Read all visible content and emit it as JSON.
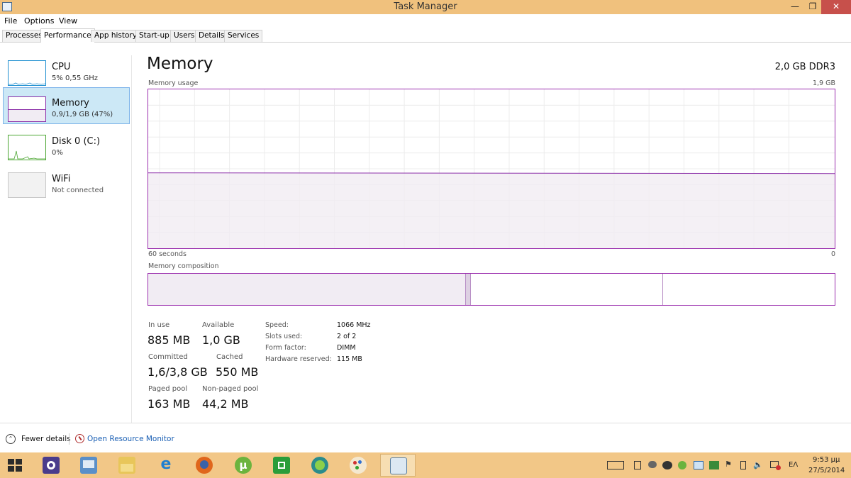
{
  "window": {
    "title": "Task Manager",
    "controls": {
      "minimize": "—",
      "maximize": "❐",
      "close": "✕"
    }
  },
  "menu": [
    "File",
    "Options",
    "View"
  ],
  "tabs": [
    {
      "label": "Processes",
      "active": false
    },
    {
      "label": "Performance",
      "active": true
    },
    {
      "label": "App history",
      "active": false
    },
    {
      "label": "Start-up",
      "active": false
    },
    {
      "label": "Users",
      "active": false
    },
    {
      "label": "Details",
      "active": false
    },
    {
      "label": "Services",
      "active": false
    }
  ],
  "sidebar": [
    {
      "name": "CPU",
      "sub": "5% 0,55 GHz",
      "color": "#1f8fd0"
    },
    {
      "name": "Memory",
      "sub": "0,9/1,9 GB (47%)",
      "color": "#8b2fa8"
    },
    {
      "name": "Disk 0 (C:)",
      "sub": "0%",
      "color": "#4ca632"
    },
    {
      "name": "WiFi",
      "sub": "Not connected",
      "color": "#c8c8c8"
    }
  ],
  "main": {
    "title": "Memory",
    "spec": "2,0 GB DDR3",
    "usage_label": "Memory usage",
    "usage_max": "1,9 GB",
    "axis_left": "60 seconds",
    "axis_right": "0",
    "usage_fraction": 0.47,
    "composition_label": "Memory composition",
    "composition": {
      "in_use_fraction": 0.462,
      "modified_fraction": 0.008,
      "standby_fraction": 0.28
    },
    "stats": {
      "in_use_label": "In use",
      "in_use": "885 MB",
      "available_label": "Available",
      "available": "1,0 GB",
      "committed_label": "Committed",
      "committed": "1,6/3,8 GB",
      "cached_label": "Cached",
      "cached": "550 MB",
      "paged_label": "Paged pool",
      "paged": "163 MB",
      "nonpaged_label": "Non-paged pool",
      "nonpaged": "44,2 MB"
    },
    "specs": [
      {
        "label": "Speed:",
        "value": "1066 MHz"
      },
      {
        "label": "Slots used:",
        "value": "2 of 2"
      },
      {
        "label": "Form factor:",
        "value": "DIMM"
      },
      {
        "label": "Hardware reserved:",
        "value": "115 MB"
      }
    ]
  },
  "footer": {
    "fewer_details": "Fewer details",
    "resource_monitor": "Open Resource Monitor"
  },
  "taskbar": {
    "language": "EΛ",
    "time": "9:53 μμ",
    "date": "27/5/2014",
    "apps": [
      "start-windows-icon",
      "settings-gear-icon",
      "remote-desktop-icon",
      "file-explorer-icon",
      "internet-explorer-icon",
      "firefox-icon",
      "utorrent-icon",
      "windows-store-icon",
      "globe-sync-icon",
      "paint-icon",
      "task-manager-icon"
    ]
  },
  "colors": {
    "memory_accent": "#8b2fa8",
    "graph_fill": "#f1ecf3",
    "selected_bg": "#cce8f6",
    "taskbar": "#f2c787"
  }
}
